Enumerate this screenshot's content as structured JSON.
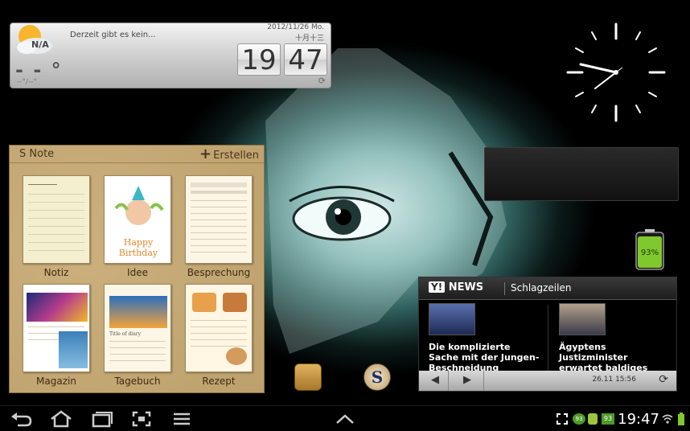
{
  "weather": {
    "na": "N/A",
    "temp": "- - °",
    "temp_small": "--°/--°",
    "status": "Derzeit gibt es kein...",
    "date": "2012/11/26 Mo.",
    "lunar": "十月十三",
    "hour": "19",
    "minute": "47",
    "refresh_icon": "refresh-icon"
  },
  "snote": {
    "title": "S Note",
    "create_label": "Erstellen",
    "templates": [
      {
        "label": "Notiz"
      },
      {
        "label": "Idee",
        "card_text": "Happy Birthday"
      },
      {
        "label": "Besprechung"
      },
      {
        "label": "Magazin"
      },
      {
        "label": "Tagebuch",
        "card_text": "Title of diary"
      },
      {
        "label": "Rezept"
      }
    ]
  },
  "dock": {
    "app_letter": "S"
  },
  "battery": {
    "percent_label": "93%",
    "level": 0.93,
    "color": "#7fc82e"
  },
  "news": {
    "brand": "NEWS",
    "brand_mark": "Y!",
    "section": "Schlagzeilen",
    "stories": [
      {
        "headline": "Die komplizierte Sache mit der Jungen-Beschneidung"
      },
      {
        "headline": "Ägyptens Justizminister erwartet baldiges Ende der politischen Krise"
      }
    ],
    "timestamp": "26.11   15:56"
  },
  "status_bar": {
    "time": "19:47",
    "badge_1": "93",
    "badge_2": "93"
  },
  "colors": {
    "snote_bg": "#c7a972",
    "accent_green": "#7fc82e"
  }
}
